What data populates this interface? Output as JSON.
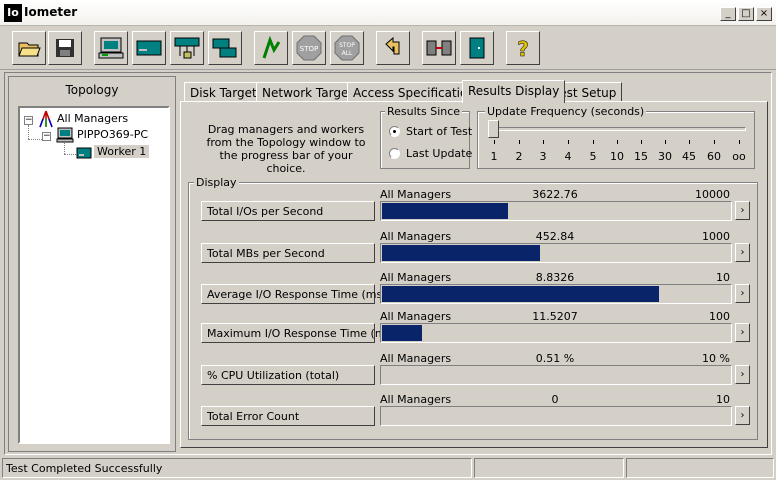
{
  "window": {
    "title": "Iometer",
    "logo_text": "Io"
  },
  "toolbar": {
    "buttons": [
      {
        "name": "open-folder-icon"
      },
      {
        "name": "save-icon"
      },
      {
        "name": "new-manager-icon"
      },
      {
        "name": "disk-worker-icon"
      },
      {
        "name": "network-worker-icon"
      },
      {
        "name": "duplicate-worker-icon"
      },
      {
        "name": "start-tests-icon"
      },
      {
        "name": "stop-icon",
        "text": "STOP"
      },
      {
        "name": "stop-all-icon",
        "text": "STOP ALL"
      },
      {
        "name": "reset-workers-icon"
      },
      {
        "name": "disconnect-icon"
      },
      {
        "name": "exit-icon"
      },
      {
        "name": "help-icon"
      }
    ]
  },
  "topology": {
    "title": "Topology",
    "root": "All Managers",
    "manager": "PIPPO369-PC",
    "worker": "Worker 1"
  },
  "tabs": [
    "Disk Targets",
    "Network Targets",
    "Access Specifications",
    "Results Display",
    "Test Setup"
  ],
  "drag_hint": "Drag managers and workers from the Topology window to the progress bar of your choice.",
  "results_since": {
    "label": "Results Since",
    "options": [
      "Start of Test",
      "Last Update"
    ],
    "selected": 0
  },
  "update_frequency": {
    "label": "Update Frequency (seconds)",
    "ticks": [
      "1",
      "2",
      "3",
      "4",
      "5",
      "10",
      "15",
      "30",
      "45",
      "60",
      "oo"
    ],
    "selected_index": 0
  },
  "display": {
    "label": "Display",
    "rows": [
      {
        "button": "Total I/Os per Second",
        "source": "All Managers",
        "value": "3622.76",
        "max": "10000",
        "fill": 0.362
      },
      {
        "button": "Total MBs per Second",
        "source": "All Managers",
        "value": "452.84",
        "max": "1000",
        "fill": 0.453
      },
      {
        "button": "Average I/O Response Time (ms)",
        "source": "All Managers",
        "value": "8.8326",
        "max": "10",
        "fill": 0.797
      },
      {
        "button": "Maximum I/O Response Time (ms)",
        "source": "All Managers",
        "value": "11.5207",
        "max": "100",
        "fill": 0.115
      },
      {
        "button": "% CPU Utilization (total)",
        "source": "All Managers",
        "value": "0.51 %",
        "max": "10 %",
        "fill": 0.0
      },
      {
        "button": "Total Error Count",
        "source": "All Managers",
        "value": "0",
        "max": "10",
        "fill": 0.0
      }
    ]
  },
  "status": {
    "message": "Test Completed Successfully"
  },
  "colors": {
    "bar_fill": "#0a246a",
    "face": "#d4d0c8"
  }
}
